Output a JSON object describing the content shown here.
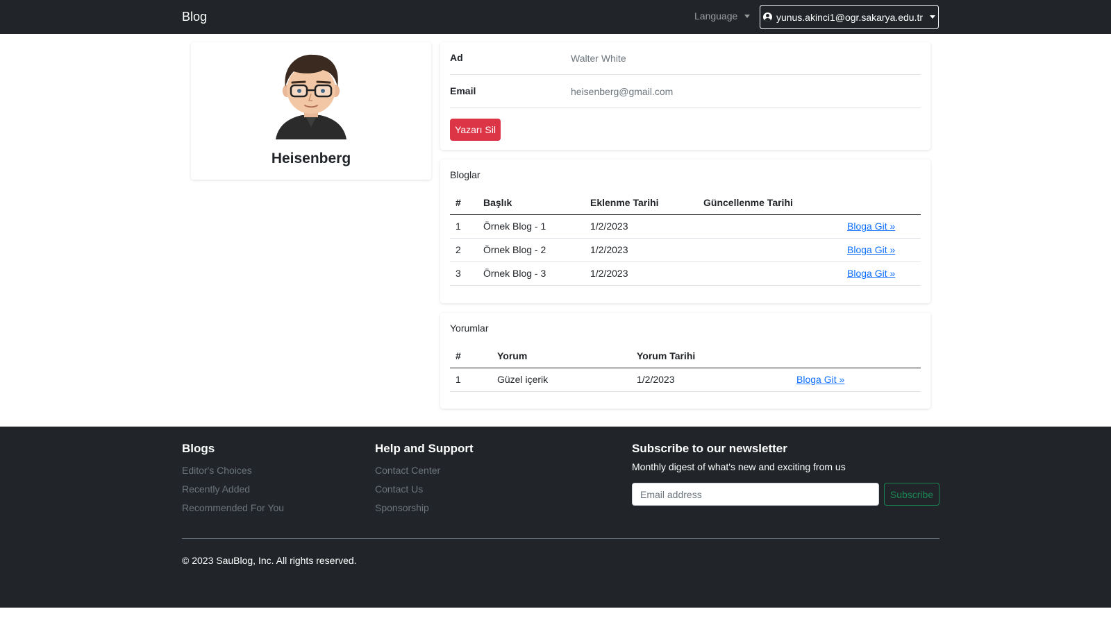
{
  "navbar": {
    "brand": "Blog",
    "language_label": "Language",
    "user_email": "yunus.akinci1@ogr.sakarya.edu.tr"
  },
  "profile": {
    "name": "Heisenberg",
    "avatar_icon": "avatar-illustration"
  },
  "info": {
    "rows": [
      {
        "label": "Ad",
        "value": "Walter White"
      },
      {
        "label": "Email",
        "value": "heisenberg@gmail.com"
      }
    ],
    "delete_label": "Yazarı Sil"
  },
  "blogs": {
    "title": "Bloglar",
    "headers": [
      "#",
      "Başlık",
      "Eklenme Tarihi",
      "Güncellenme Tarihi",
      ""
    ],
    "rows": [
      {
        "id": "1",
        "title": "Örnek Blog - 1",
        "created": "1/2/2023",
        "updated": "",
        "link": "Bloga Git »"
      },
      {
        "id": "2",
        "title": "Örnek Blog - 2",
        "created": "1/2/2023",
        "updated": "",
        "link": "Bloga Git »"
      },
      {
        "id": "3",
        "title": "Örnek Blog - 3",
        "created": "1/2/2023",
        "updated": "",
        "link": "Bloga Git »"
      }
    ]
  },
  "comments": {
    "title": "Yorumlar",
    "headers": [
      "#",
      "Yorum",
      "Yorum Tarihi",
      ""
    ],
    "rows": [
      {
        "id": "1",
        "text": "Güzel içerik",
        "date": "1/2/2023",
        "link": "Bloga Git »"
      }
    ]
  },
  "footer": {
    "col1": {
      "title": "Blogs",
      "links": [
        "Editor's Choices",
        "Recently Added",
        "Recommended For You"
      ]
    },
    "col2": {
      "title": "Help and Support",
      "links": [
        "Contact Center",
        "Contact Us",
        "Sponsorship"
      ]
    },
    "newsletter": {
      "title": "Subscribe to our newsletter",
      "subtitle": "Monthly digest of what's new and exciting from us",
      "placeholder": "Email address",
      "button": "Subscribe"
    },
    "copyright": "© 2023 SauBlog, Inc. All rights reserved."
  },
  "colors": {
    "navbar_bg": "#212529",
    "danger": "#dc3545",
    "link": "#0d6efd",
    "success": "#198754"
  }
}
